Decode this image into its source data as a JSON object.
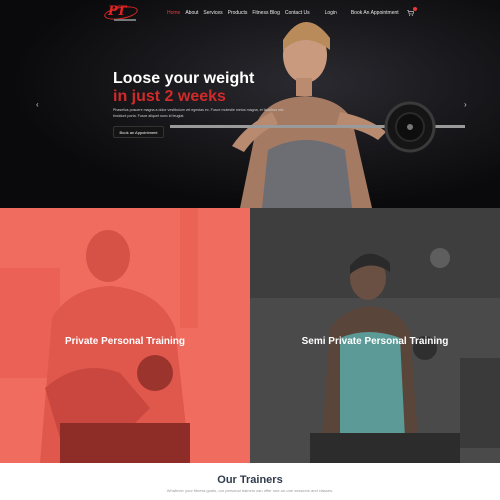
{
  "brand": {
    "logo_text": "PT"
  },
  "nav": {
    "items": [
      "Home",
      "About",
      "Services",
      "Products",
      "Fitness Blog",
      "Contact Us"
    ],
    "login": "Login",
    "appointment": "Book An Appointment"
  },
  "hero": {
    "title_line1": "Loose your weight",
    "title_line2": "in just 2 weeks",
    "description": "Phasellus posuere magna a dolor vestibulum vel egestas ex. Fusce molestie metus magna, et faucibus nisi tincidunt porta. Fusce aliquet nunc id feugiat.",
    "button": "Book an Appointment",
    "prev_icon": "chevron-left-icon",
    "next_icon": "chevron-right-icon"
  },
  "services": [
    {
      "label": "Private Personal Training"
    },
    {
      "label": "Semi Private Personal Training"
    }
  ],
  "trainers": {
    "title": "Our Trainers",
    "description": "Whatever your fitness goals, our personal trainers can offer one-on-one sessions and classes."
  },
  "colors": {
    "accent": "#d02a2a",
    "coral": "#f06c5f",
    "dark": "#0d0d0f",
    "heading": "#2f3b4c"
  }
}
